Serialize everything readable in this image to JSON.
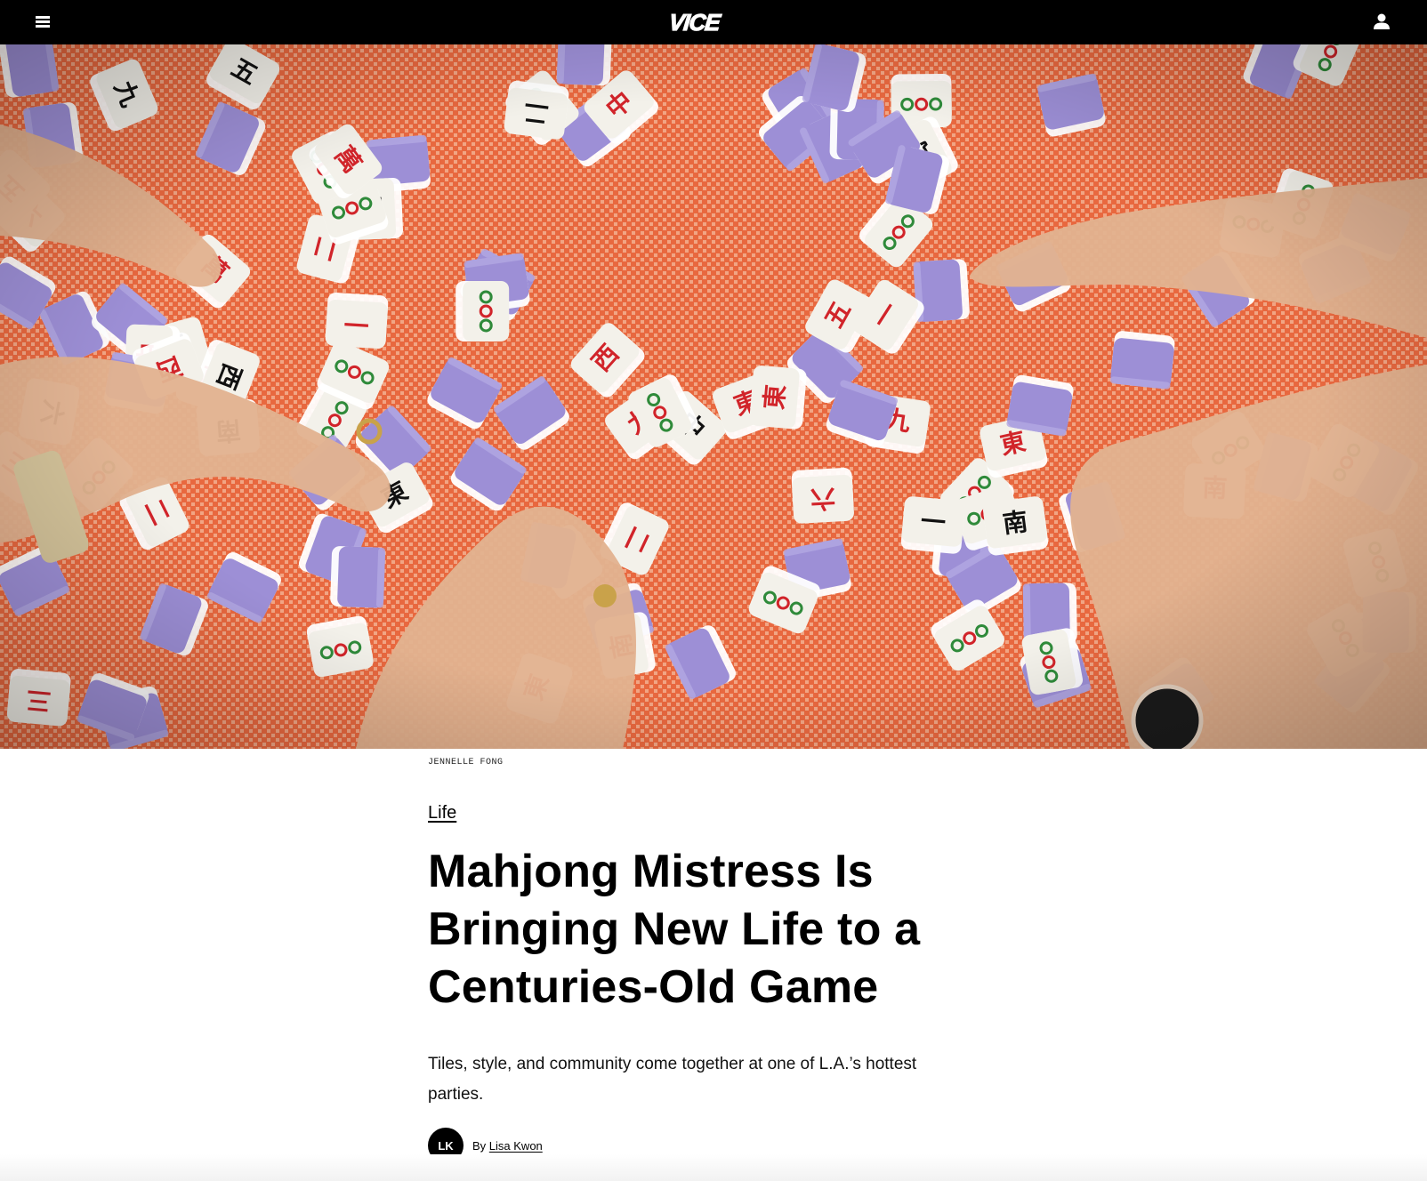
{
  "header": {
    "menu_icon": "hamburger-menu-icon",
    "logo_text": "VICE",
    "account_icon": "user-account-icon"
  },
  "hero": {
    "alt": "Hands playing mahjong with purple and white tiles on an orange patterned table",
    "tile_glyphs": [
      "中",
      "東",
      "西",
      "萬",
      "九",
      "六",
      "二",
      "三",
      "一",
      "五",
      "南"
    ],
    "colors": {
      "table": "#e8683f",
      "tile_back": "#9d8fd6",
      "tile_face": "#f3f1ea",
      "red_glyph": "#d1242a",
      "green_glyph": "#2f8a3a"
    }
  },
  "article": {
    "photo_credit": "JENNELLE FONG",
    "category": "Life",
    "headline": "Mahjong Mistress Is Bringing New Life to a Centuries-Old Game",
    "dek": "Tiles, style, and community come together at one of L.A.’s hottest parties.",
    "byline_prefix": "By",
    "author_initials": "LK",
    "author_name": "Lisa Kwon"
  }
}
